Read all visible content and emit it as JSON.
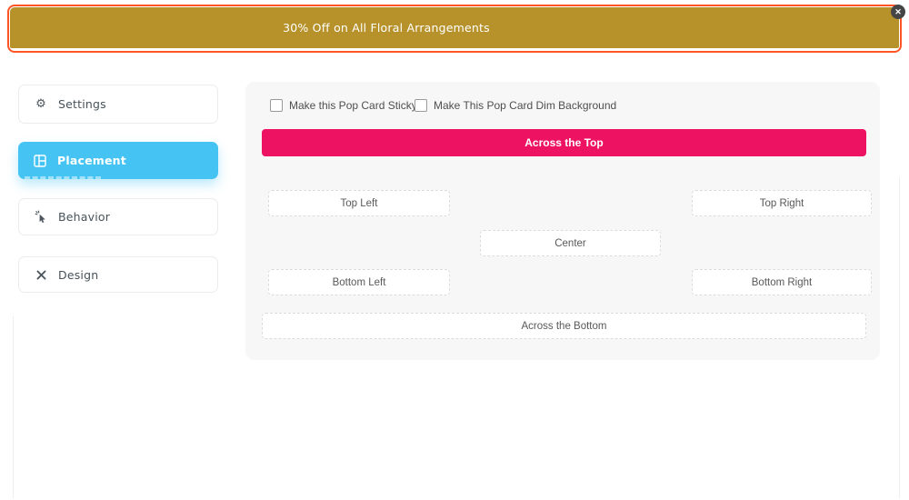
{
  "colors": {
    "banner-bg": "#b7922b",
    "selection-border": "#ff5526",
    "active-tab": "#45c4f3",
    "selected-pos": "#ed1362",
    "panel-bg": "#f7f7f8"
  },
  "banner": {
    "text": "30% Off on All Floral Arrangements",
    "close_label": "✕"
  },
  "sidebar": {
    "items": [
      {
        "label": "Settings",
        "icon": "gear-icon",
        "glyph": "⚙",
        "active": false
      },
      {
        "label": "Placement",
        "icon": "layout-grid-icon",
        "active": true
      },
      {
        "label": "Behavior",
        "icon": "cursor-click-icon",
        "active": false
      },
      {
        "label": "Design",
        "icon": "design-tools-icon",
        "active": false
      }
    ]
  },
  "panel": {
    "checkboxes": [
      {
        "label": "Make this Pop Card Sticky",
        "checked": false
      },
      {
        "label": "Make This Pop Card Dim Background",
        "checked": false
      }
    ],
    "positions": {
      "across_top": "Across the Top",
      "top_left": "Top Left",
      "top_right": "Top Right",
      "center": "Center",
      "bottom_left": "Bottom Left",
      "bottom_right": "Bottom Right",
      "across_bottom": "Across the Bottom"
    },
    "selected": "across_top"
  }
}
